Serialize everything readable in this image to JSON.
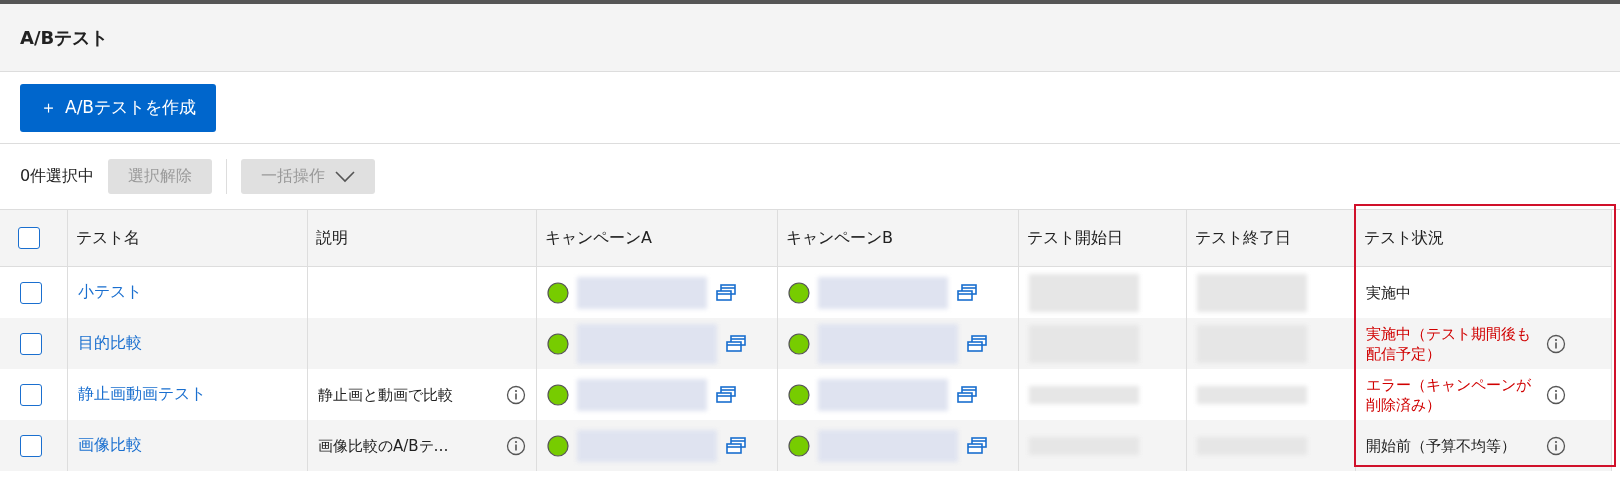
{
  "page": {
    "title": "A/Bテスト"
  },
  "create_button": {
    "icon": "＋",
    "label": "A/Bテストを作成"
  },
  "toolbar": {
    "selection_count": "0件選択中",
    "clear_button": {
      "label": "選択解除",
      "disabled": true
    },
    "bulk_button": {
      "label": "一括操作",
      "disabled": true
    }
  },
  "table": {
    "select_all": {
      "checked": false
    },
    "columns": [
      {
        "label": "テスト名",
        "highlighted": false
      },
      {
        "label": "説明",
        "highlighted": false
      },
      {
        "label": "キャンペーンA",
        "highlighted": false
      },
      {
        "label": "キャンペーンB",
        "highlighted": false
      },
      {
        "label": "テスト開始日",
        "highlighted": false
      },
      {
        "label": "テスト終了日",
        "highlighted": false
      },
      {
        "label": "テスト状況",
        "highlighted": true
      }
    ],
    "rows": [
      {
        "checked": false,
        "name": "小テスト",
        "status": {
          "text": "実施中",
          "alert": false,
          "info": false
        }
      },
      {
        "checked": false,
        "name": "目的比較",
        "status": {
          "text": "実施中（テスト期間後も配信予定）",
          "alert": true,
          "info": true
        }
      },
      {
        "checked": false,
        "name": "静止画動画テスト",
        "description": {
          "text": "静止画と動画で比較",
          "info": true
        },
        "status": {
          "text": "エラー（キャンペーンが削除済み）",
          "alert": true,
          "info": true
        }
      },
      {
        "checked": false,
        "name": "画像比較",
        "description": {
          "text": "画像比較のA/Bテ…",
          "info": true
        },
        "status": {
          "text": "開始前（予算不均等）",
          "alert": false,
          "info": true
        }
      }
    ]
  }
}
